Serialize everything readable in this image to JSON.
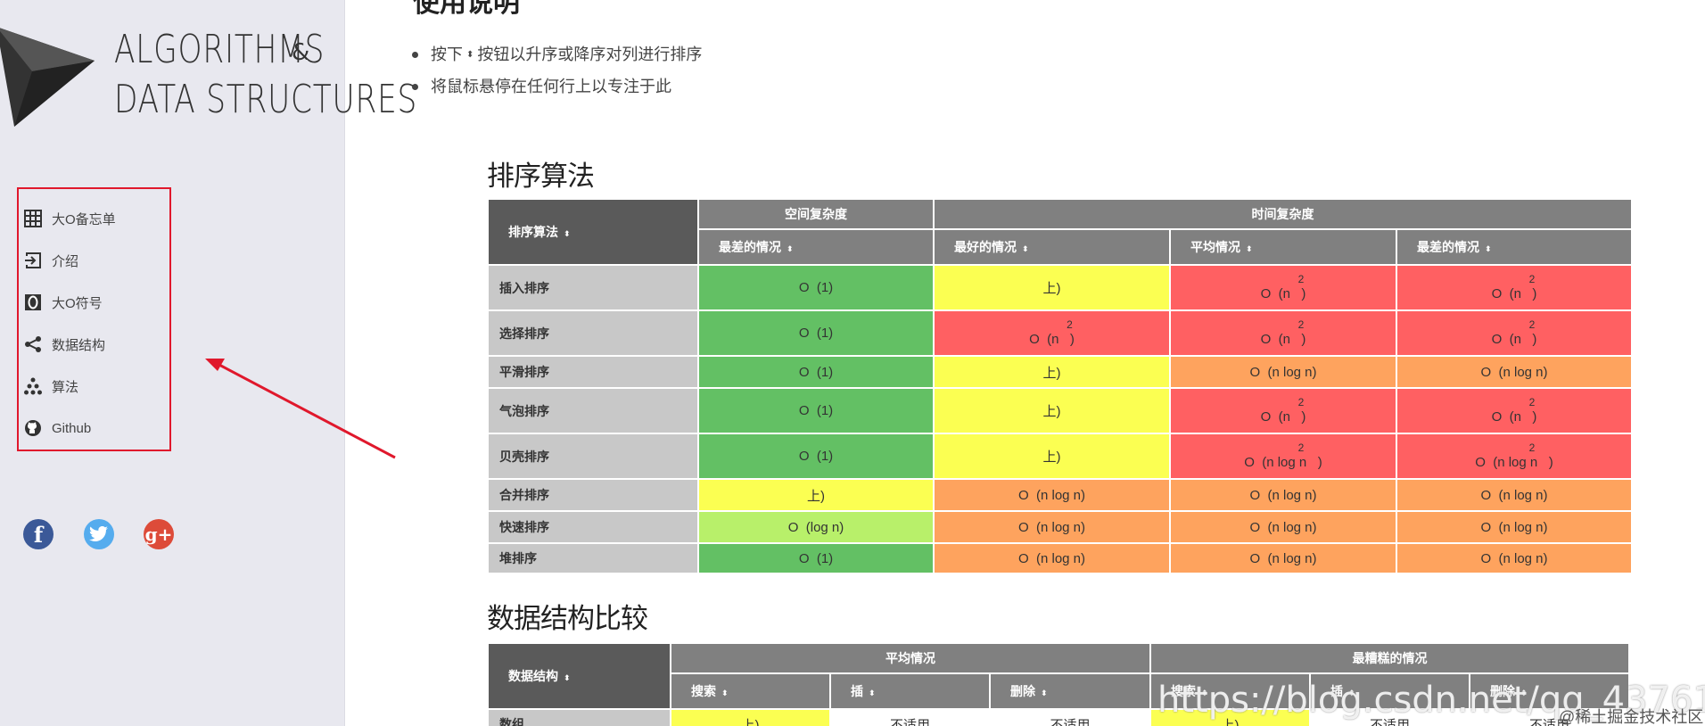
{
  "logo": {
    "line1": "ALGORITHMS",
    "amp": "&",
    "line2": "DATA STRUCTURES"
  },
  "sidebar": {
    "items": [
      {
        "label": "大O备忘单",
        "icon": "table-grid-icon"
      },
      {
        "label": "介绍",
        "icon": "sign-in-icon"
      },
      {
        "label": "大O符号",
        "icon": "letter-o-icon"
      },
      {
        "label": "数据结构",
        "icon": "share-nodes-icon"
      },
      {
        "label": "算法",
        "icon": "tree-dots-icon"
      },
      {
        "label": "Github",
        "icon": "github-icon"
      }
    ],
    "social": [
      {
        "name": "facebook-icon",
        "glyph": "f",
        "color": "#3b5998"
      },
      {
        "name": "twitter-icon",
        "glyph": "t",
        "color": "#55acee"
      },
      {
        "name": "google-plus-icon",
        "glyph": "g+",
        "color": "#dd4b39"
      }
    ]
  },
  "main": {
    "top_heading": "使用说明",
    "bullets": {
      "b1_pre": "按下",
      "b1_post": "按钮以升序或降序对列进行排序",
      "b2": "将鼠标悬停在任何行上以专注于此"
    }
  },
  "sorting": {
    "title": "排序算法",
    "row_header": "排序算法",
    "group_space": "空间复杂度",
    "group_time": "时间复杂度",
    "sub_worst_space": "最差的情况",
    "sub_best": "最好的情况",
    "sub_avg": "平均情况",
    "sub_worst": "最差的情况",
    "rows": [
      {
        "name": "插入排序",
        "space": {
          "text": "O  (1)",
          "sup": ""
        },
        "best": {
          "text": "上)",
          "sup": ""
        },
        "avg": {
          "text": "O  (n   )",
          "sup": "2"
        },
        "worst": {
          "text": "O  (n   )",
          "sup": "2"
        }
      },
      {
        "name": "选择排序",
        "space": {
          "text": "O  (1)",
          "sup": ""
        },
        "best": {
          "text": "O  (n   )",
          "sup": "2"
        },
        "avg": {
          "text": "O  (n   )",
          "sup": "2"
        },
        "worst": {
          "text": "O  (n   )",
          "sup": "2"
        }
      },
      {
        "name": "平滑排序",
        "space": {
          "text": "O  (1)",
          "sup": ""
        },
        "best": {
          "text": "上)",
          "sup": ""
        },
        "avg": {
          "text": "O  (n log n)",
          "sup": ""
        },
        "worst": {
          "text": "O  (n log n)",
          "sup": ""
        }
      },
      {
        "name": "气泡排序",
        "space": {
          "text": "O  (1)",
          "sup": ""
        },
        "best": {
          "text": "上)",
          "sup": ""
        },
        "avg": {
          "text": "O  (n   )",
          "sup": "2"
        },
        "worst": {
          "text": "O  (n   )",
          "sup": "2"
        }
      },
      {
        "name": "贝壳排序",
        "space": {
          "text": "O  (1)",
          "sup": ""
        },
        "best": {
          "text": "上)",
          "sup": ""
        },
        "avg": {
          "text": "O  (n log n   )",
          "sup": "2"
        },
        "worst": {
          "text": "O  (n log n   )",
          "sup": "2"
        }
      },
      {
        "name": "合并排序",
        "space": {
          "text": "上)",
          "sup": ""
        },
        "best": {
          "text": "O  (n log n)",
          "sup": ""
        },
        "avg": {
          "text": "O  (n log n)",
          "sup": ""
        },
        "worst": {
          "text": "O  (n log n)",
          "sup": ""
        }
      },
      {
        "name": "快速排序",
        "space": {
          "text": "O  (log n)",
          "sup": ""
        },
        "best": {
          "text": "O  (n log n)",
          "sup": ""
        },
        "avg": {
          "text": "O  (n log n)",
          "sup": ""
        },
        "worst": {
          "text": "O  (n log n)",
          "sup": ""
        }
      },
      {
        "name": "堆排序",
        "space": {
          "text": "O  (1)",
          "sup": ""
        },
        "best": {
          "text": "O  (n log n)",
          "sup": ""
        },
        "avg": {
          "text": "O  (n log n)",
          "sup": ""
        },
        "worst": {
          "text": "O  (n log n)",
          "sup": ""
        }
      }
    ],
    "colors": [
      [
        "green",
        "yellow",
        "red",
        "red"
      ],
      [
        "green",
        "red",
        "red",
        "red"
      ],
      [
        "green",
        "yellow",
        "orange",
        "orange"
      ],
      [
        "green",
        "yellow",
        "red",
        "red"
      ],
      [
        "green",
        "yellow",
        "red",
        "red"
      ],
      [
        "yellow",
        "orange",
        "orange",
        "orange"
      ],
      [
        "lgreen",
        "orange",
        "orange",
        "orange"
      ],
      [
        "green",
        "orange",
        "orange",
        "orange"
      ]
    ]
  },
  "ds": {
    "title": "数据结构比较",
    "row_header": "数据结构",
    "group_avg": "平均情况",
    "group_worst": "最糟糕的情况",
    "sub_search": "搜索",
    "sub_insert": "插",
    "sub_delete": "删除",
    "sub_search2": "搜索",
    "sub_insert2": "插",
    "sub_delete2": "删除",
    "first_row": {
      "name": "数组",
      "c1": "上)",
      "c2": "不适用",
      "c3": "不适用",
      "c4": "上)",
      "c5": "不适用",
      "c6": "不适用"
    }
  },
  "watermark": {
    "url": "https://blog.csdn.net/qq_43761",
    "credit": "@稀土掘金技术社区"
  }
}
